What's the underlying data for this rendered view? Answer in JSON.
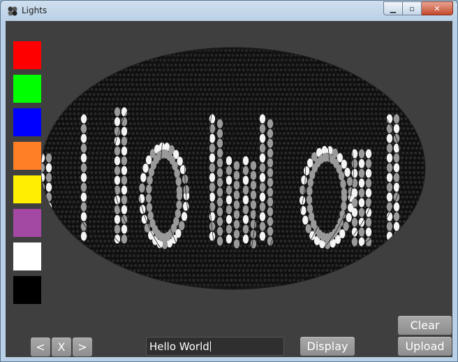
{
  "window": {
    "title": "Lights"
  },
  "palette": [
    {
      "name": "red",
      "color": "#ff0000"
    },
    {
      "name": "green",
      "color": "#00ff00"
    },
    {
      "name": "blue",
      "color": "#0000ff"
    },
    {
      "name": "orange",
      "color": "#ff7f27"
    },
    {
      "name": "yellow",
      "color": "#ffee00"
    },
    {
      "name": "purple",
      "color": "#a349a4"
    },
    {
      "name": "white",
      "color": "#ffffff"
    },
    {
      "name": "black",
      "color": "#000000"
    }
  ],
  "nav": {
    "prev_label": "<",
    "clear_x_label": "X",
    "next_label": ">"
  },
  "message": {
    "value": "Hello World"
  },
  "buttons": {
    "display_label": "Display",
    "clear_label": "Clear",
    "upload_label": "Upload"
  }
}
